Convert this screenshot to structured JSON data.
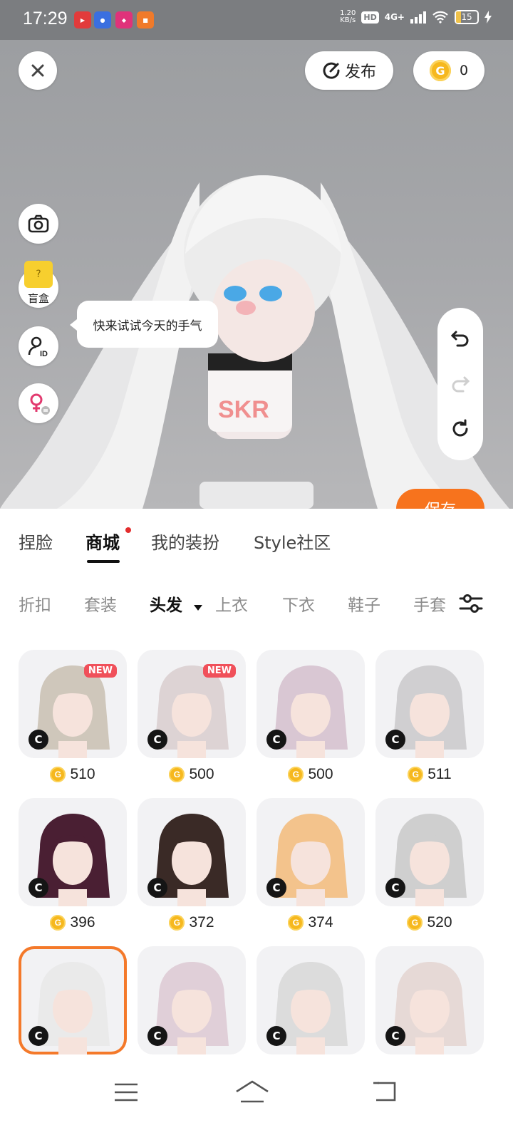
{
  "status_bar": {
    "time": "17:29",
    "net_speed_top": "1.20",
    "net_speed_bottom": "KB/s",
    "hd": "HD",
    "signal": "4G+",
    "battery": "15"
  },
  "header": {
    "publish_label": "发布",
    "coin_balance": "0"
  },
  "side": {
    "blindbox_label": "盲盒",
    "tooltip": "快来试试今天的手气",
    "avatar_text": "SKR"
  },
  "save_label": "保存",
  "main_tabs": [
    "捏脸",
    "商城",
    "我的装扮",
    "Style社区"
  ],
  "sub_tabs": [
    "折扣",
    "套装",
    "头发",
    "上衣",
    "下衣",
    "鞋子",
    "手套"
  ],
  "badge_new": "NEW",
  "items": [
    {
      "price": "510",
      "new": true,
      "hair": "#cfc7bb"
    },
    {
      "price": "500",
      "new": true,
      "hair": "#ddd3d4"
    },
    {
      "price": "500",
      "new": false,
      "hair": "#d9c7d3"
    },
    {
      "price": "511",
      "new": false,
      "hair": "#d0cfd1"
    },
    {
      "price": "396",
      "new": false,
      "hair": "#4a1f33"
    },
    {
      "price": "372",
      "new": false,
      "hair": "#3a2a26"
    },
    {
      "price": "374",
      "new": false,
      "hair": "#f3c38c"
    },
    {
      "price": "520",
      "new": false,
      "hair": "#cfcfcf"
    },
    {
      "price": "",
      "new": false,
      "hair": "#eaeaea",
      "selected": true
    },
    {
      "price": "",
      "new": false,
      "hair": "#e0cfd8"
    },
    {
      "price": "",
      "new": false,
      "hair": "#dcdcdc"
    },
    {
      "price": "",
      "new": false,
      "hair": "#e6d9d6"
    }
  ],
  "colors": {
    "accent": "#f7731d",
    "coin": "#f6b81e",
    "new_badge": "#f0505a"
  }
}
